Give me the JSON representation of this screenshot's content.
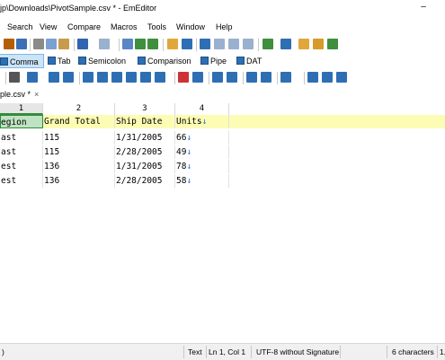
{
  "window": {
    "title": "jp\\Downloads\\PivotSample.csv * - EmEditor",
    "minimize": "–"
  },
  "menu": [
    "Search",
    "View",
    "Compare",
    "Macros",
    "Tools",
    "Window",
    "Help"
  ],
  "csv_modes": [
    "Comma",
    "Tab",
    "Semicolon",
    "Comparison",
    "Pipe",
    "DAT"
  ],
  "active_csv_mode": "Comma",
  "tab": {
    "label": "ple.csv *",
    "close": "×"
  },
  "columns": [
    "1",
    "2",
    "3",
    "4"
  ],
  "grid": {
    "header": [
      "egion",
      "Grand Total",
      "Ship Date",
      "Units"
    ],
    "header_arrow": "↓",
    "rows": [
      [
        "ast",
        "115",
        "1/31/2005",
        "66"
      ],
      [
        "ast",
        "115",
        "2/28/2005",
        "49"
      ],
      [
        "est",
        "136",
        "1/31/2005",
        "78"
      ],
      [
        "est",
        "136",
        "2/28/2005",
        "58"
      ]
    ]
  },
  "status": {
    "left": ")",
    "mode": "Text",
    "position": "Ln 1, Col 1",
    "encoding": "UTF-8 without Signature",
    "chars": "6 characters",
    "extra": "1,"
  },
  "colors": {
    "header_row": "#fdfcb4",
    "selected_cell": "#bfe3c2",
    "arrow": "#1e73d6",
    "tab_active": "#cce4f7"
  },
  "icons": [
    "save-icon",
    "cut-icon",
    "copy-icon",
    "paste-icon",
    "undo-icon",
    "redo-icon",
    "find-icon",
    "find-next-icon",
    "find-prev-icon",
    "highlight-icon",
    "filter-icon",
    "csv-icon",
    "sort-asc-icon",
    "sort-desc-icon",
    "split-icon",
    "ruler-icon",
    "spell-icon",
    "wrap-icon"
  ]
}
